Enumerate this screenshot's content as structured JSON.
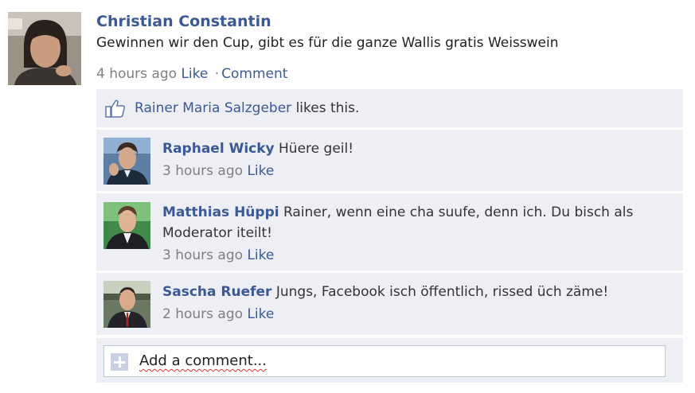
{
  "post": {
    "author": "Christian Constantin",
    "text": "Gewinnen wir den Cup, gibt es für die ganze Wallis gratis Weisswein",
    "time": "4 hours ago",
    "like_label": "Like",
    "separator": "·",
    "comment_label": "Comment"
  },
  "likes": {
    "name": "Rainer Maria Salzgeber",
    "text": " likes this."
  },
  "comments": [
    {
      "author": "Raphael Wicky",
      "text": " Hüere geil!",
      "time": "3 hours ago",
      "like_label": "Like"
    },
    {
      "author": "Matthias Hüppi",
      "text": " Rainer, wenn eine cha suufe, denn ich. Du bisch als Moderator iteilt!",
      "time": "3 hours ago",
      "like_label": "Like"
    },
    {
      "author": "Sascha Ruefer",
      "text": " Jungs, Facebook isch öffentlich, rissed üch zäme!",
      "time": "2 hours ago",
      "like_label": "Like"
    }
  ],
  "add_comment": {
    "placeholder": "Add a comment..."
  },
  "colors": {
    "link": "#3b5998",
    "panel": "#edeff4",
    "meta": "#808080",
    "border": "#bdc7d8"
  },
  "icons": [
    "thumbs-up-icon",
    "plus-icon"
  ]
}
